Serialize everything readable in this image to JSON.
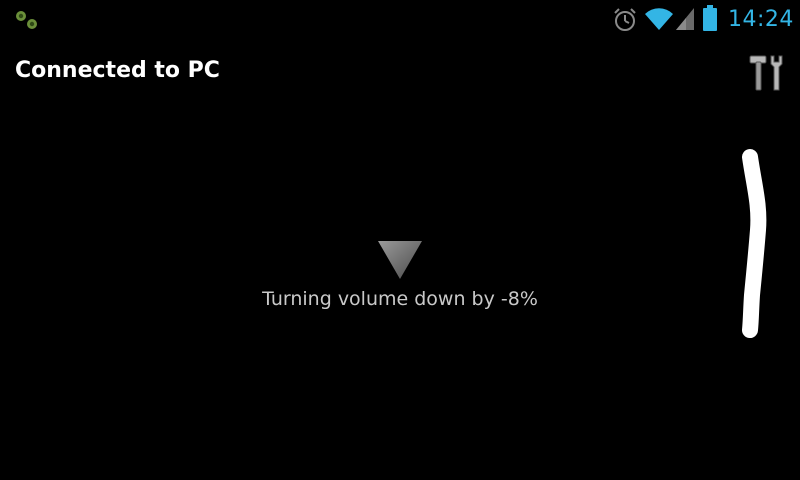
{
  "status_bar": {
    "notification_icon": "app-notification-icon",
    "icons": [
      "alarm-icon",
      "wifi-icon",
      "signal-icon",
      "battery-icon"
    ],
    "time": "14:24",
    "accent_color": "#33b5e5"
  },
  "header": {
    "title": "Connected to PC",
    "settings_icon": "tools-icon"
  },
  "main": {
    "indicator_icon": "triangle-down-icon",
    "message": "Turning volume down by -8%"
  },
  "gesture": {
    "icon": "swipe-trail",
    "color": "#ffffff"
  }
}
